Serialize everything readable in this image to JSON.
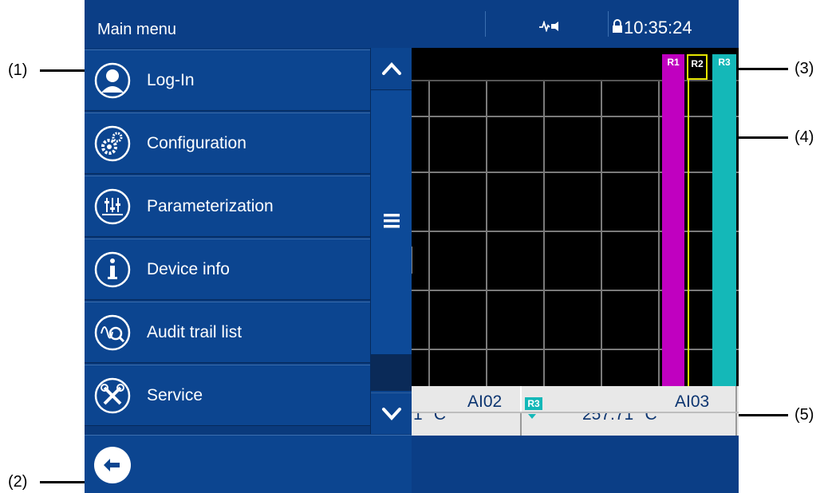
{
  "callouts": [
    "(1)",
    "(2)",
    "(3)",
    "(4)",
    "(5)"
  ],
  "menu": {
    "title": "Main menu",
    "items": [
      {
        "label": "Log-In",
        "icon": "user-icon"
      },
      {
        "label": "Configuration",
        "icon": "gears-icon"
      },
      {
        "label": "Parameterization",
        "icon": "sliders-icon"
      },
      {
        "label": "Device info",
        "icon": "info-icon"
      },
      {
        "label": "Audit trail list",
        "icon": "audit-trail-icon"
      },
      {
        "label": "Service",
        "icon": "tools-icon"
      }
    ]
  },
  "status_bar": {
    "time": "10:35:24"
  },
  "chart": {
    "channel_tags": [
      "R1",
      "R2",
      "R3"
    ],
    "channel_left": "AI02",
    "channel_right": "AI03",
    "value_left": "1 °C",
    "value_right": "257.71 °C",
    "badge": "R3"
  },
  "colors": {
    "panel_blue": "#0c4590",
    "magenta": "#c000c0",
    "yellow": "#e6e600",
    "teal": "#14b8b8"
  }
}
